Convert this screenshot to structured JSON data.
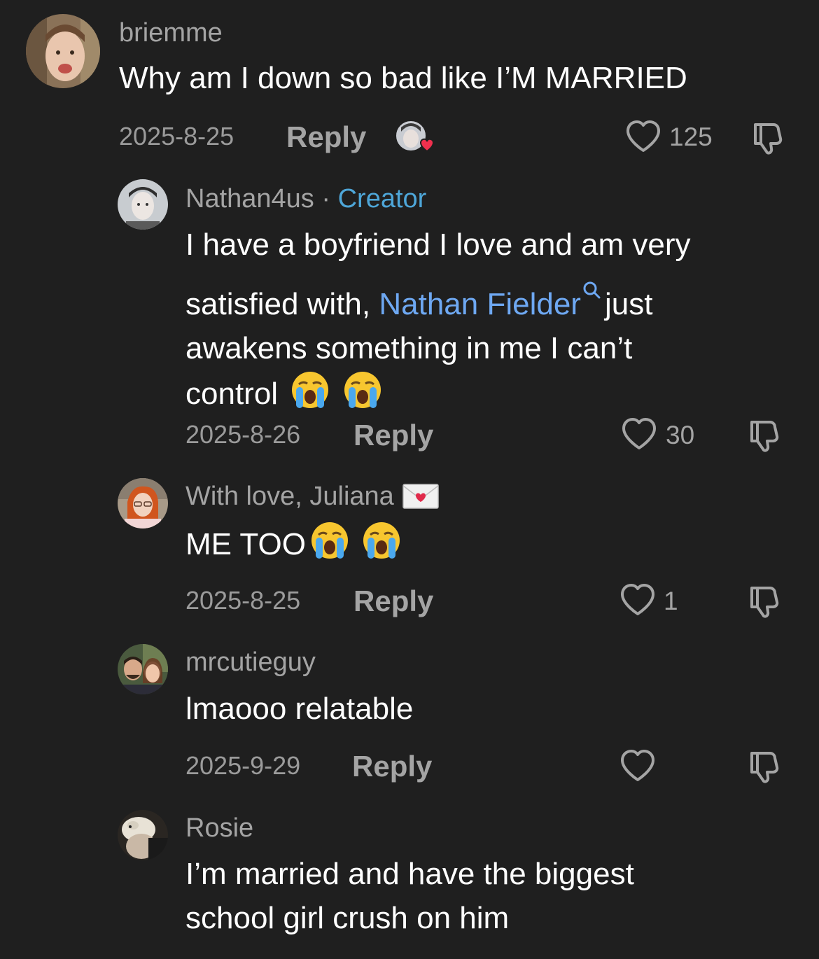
{
  "comments": [
    {
      "username": "briemme",
      "text": "Why am I down so bad like I’M MARRIED",
      "date": "2025-8-25",
      "reply_label": "Reply",
      "likes": "125"
    },
    {
      "username": "Nathan4us",
      "separator": "·",
      "badge": "Creator",
      "text_line1": "I have a boyfriend I love and am very",
      "text_line2_before": "satisfied with,",
      "text_link": "Nathan Fielder",
      "text_line2_after": "just",
      "text_line3": "awakens something in me I can’t",
      "text_line4": "control",
      "date": "2025-8-26",
      "reply_label": "Reply",
      "likes": "30"
    },
    {
      "username": "With love, Juliana",
      "text": "ME TOO",
      "date": "2025-8-25",
      "reply_label": "Reply",
      "likes": "1"
    },
    {
      "username": "mrcutieguy",
      "text": "lmaooo relatable",
      "date": "2025-9-29",
      "reply_label": "Reply",
      "likes": ""
    },
    {
      "username": "Rosie",
      "text_line1": "I’m married and have the biggest",
      "text_line2": "school girl crush on him"
    }
  ],
  "colors": {
    "background": "#1f1f1f",
    "creator_badge": "#4ea6d8",
    "link": "#6ea8f2",
    "secondary_text": "#a4a4a4"
  },
  "icons": [
    "heart-outline-icon",
    "thumbs-down-icon",
    "search-icon",
    "crying-emoji",
    "love-letter-emoji"
  ]
}
